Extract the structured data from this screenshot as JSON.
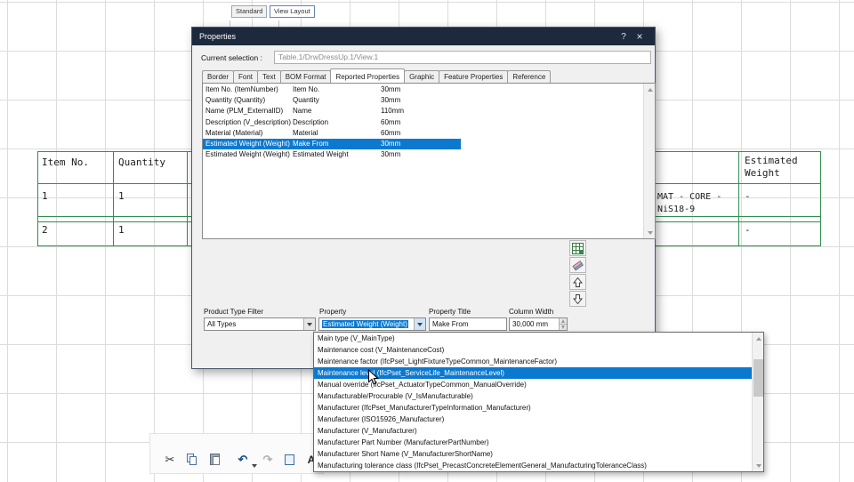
{
  "drawing": {
    "col1_header": "Item No.",
    "col2_header": "Quantity",
    "rows": [
      {
        "item": "1",
        "qty": "1"
      },
      {
        "item": "2",
        "qty": "1"
      }
    ],
    "material_line1": "MAT - CORE -",
    "material_line2": "NiS18-9",
    "weight_header_line1": "Estimated",
    "weight_header_line2": "Weight",
    "weight_values": [
      "-",
      "-"
    ],
    "line_color": "#2f8f4f"
  },
  "dialog": {
    "title": "Properties",
    "help": "?",
    "close": "×",
    "selection_label": "Current selection :",
    "selection_value": "Table.1/DrwDressUp.1/View.1",
    "tabs": [
      "Border",
      "Font",
      "Text",
      "BOM Format",
      "Reported Properties",
      "Graphic",
      "Feature Properties",
      "Reference"
    ],
    "active_tab": "Reported Properties",
    "list_rows": [
      {
        "property": "Item No. (ItemNumber)",
        "title": "Item No.",
        "width": "30mm"
      },
      {
        "property": "Quantity (Quantity)",
        "title": "Quantity",
        "width": "30mm"
      },
      {
        "property": "Name (PLM_ExternalID)",
        "title": "Name",
        "width": "110mm"
      },
      {
        "property": "Description (V_description)",
        "title": "Description",
        "width": "60mm"
      },
      {
        "property": "Material (Material)",
        "title": "Material",
        "width": "60mm"
      },
      {
        "property": "Estimated Weight (Weight)",
        "title": "Make From",
        "width": "30mm"
      },
      {
        "property": "Estimated Weight (Weight)",
        "title": "Estimated Weight",
        "width": "30mm"
      }
    ],
    "selected_row_index": 5,
    "filter_label": "Product Type Filter",
    "filter_value": "All Types",
    "property_label": "Property",
    "property_value": "Estimated Weight (Weight)",
    "property_title_label": "Property Title",
    "property_title_value": "Make From",
    "column_width_label": "Column Width",
    "column_width_value": "30,000 mm",
    "accent_color": "#0b79d0",
    "titlebar_color": "#1d2a3e"
  },
  "dropdown": {
    "items": [
      "Main type (V_MainType)",
      "Maintenance cost (V_MaintenanceCost)",
      "Maintenance factor (IfcPset_LightFixtureTypeCommon_MaintenanceFactor)",
      "Maintenance level (IfcPset_ServiceLife_MaintenanceLevel)",
      "Manual override (IfcPset_ActuatorTypeCommon_ManualOverride)",
      "Manufacturable/Procurable (V_IsManufacturable)",
      "Manufacturer (IfcPset_ManufacturerTypeInformation_Manufacturer)",
      "Manufacturer (ISO15926_Manufacturer)",
      "Manufacturer (V_Manufacturer)",
      "Manufacturer Part Number (ManufacturerPartNumber)",
      "Manufacturer Short Name (V_ManufacturerShortName)",
      "Manufacturing tolerance class (IfcPset_PrecastConcreteElementGeneral_ManufacturingToleranceClass)"
    ],
    "highlighted_index": 3
  },
  "toolbar": {
    "tab_standard": "Standard",
    "tab_view_layout": "View Layout",
    "cut_glyph": "✂",
    "undo_glyph": "↶",
    "redo_glyph": "↷",
    "text_tool_label": "A"
  }
}
